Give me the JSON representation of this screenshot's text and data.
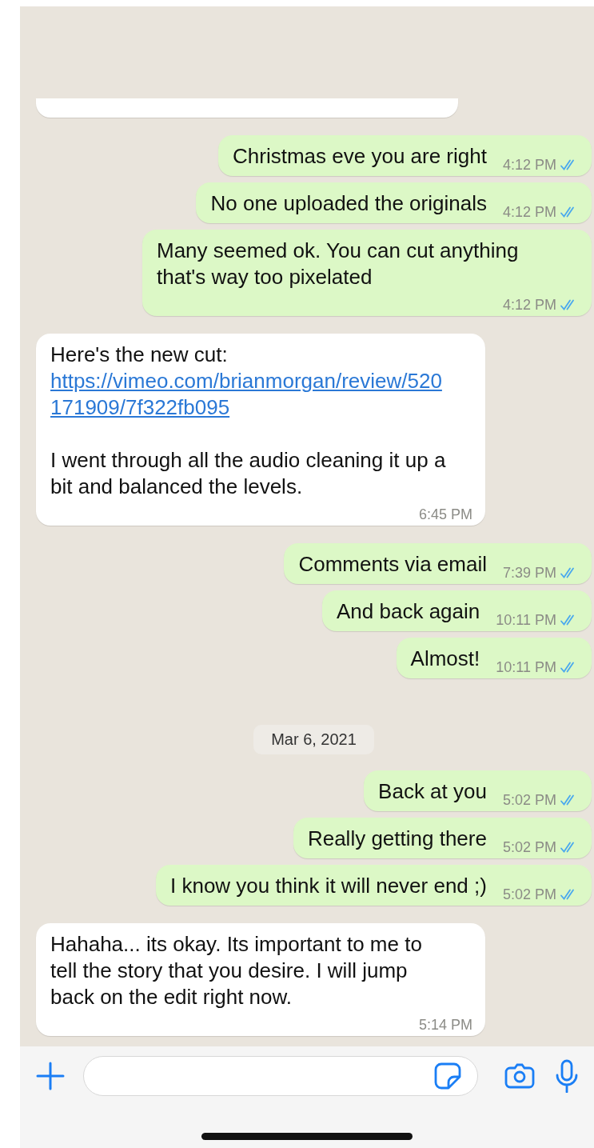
{
  "messages": [
    {
      "kind": "cut"
    },
    {
      "kind": "out",
      "text": "Christmas eve you are right",
      "time": "4:12 PM",
      "read": true
    },
    {
      "kind": "out",
      "text": "No one uploaded the originals",
      "time": "4:12 PM",
      "read": true
    },
    {
      "kind": "out",
      "text": "Many seemed ok. You can cut anything that's way too pixelated",
      "time": "4:12 PM",
      "read": true
    },
    {
      "kind": "in",
      "lead": "Here's the new cut: ",
      "link": "https://vimeo.com/brianmorgan/review/520171909/7f322fb095",
      "text": "I went through all the audio cleaning it up a bit and balanced the levels.",
      "time": "6:45 PM"
    },
    {
      "kind": "out",
      "text": "Comments via email",
      "time": "7:39 PM",
      "read": true
    },
    {
      "kind": "out",
      "text": "And back again",
      "time": "10:11 PM",
      "read": true
    },
    {
      "kind": "out",
      "text": "Almost!",
      "time": "10:11 PM",
      "read": true
    },
    {
      "kind": "date",
      "text": "Mar 6, 2021"
    },
    {
      "kind": "out",
      "text": "Back at you",
      "time": "5:02 PM",
      "read": true
    },
    {
      "kind": "out",
      "text": "Really getting there",
      "time": "5:02 PM",
      "read": true
    },
    {
      "kind": "out",
      "text": "I know you think it will never end ;)",
      "time": "5:02 PM",
      "read": true
    },
    {
      "kind": "in",
      "text": "Hahaha... its okay. Its important to me to tell the story that you desire. I will jump back on the edit right now.",
      "time": "5:14 PM"
    }
  ]
}
